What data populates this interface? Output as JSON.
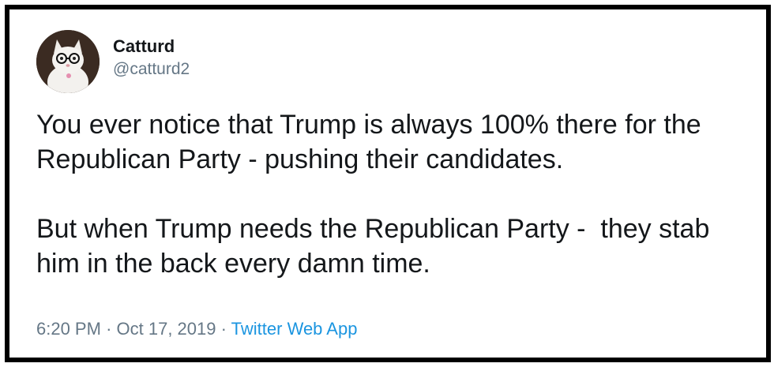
{
  "tweet": {
    "display_name": "Catturd",
    "handle": "@catturd2",
    "avatar_icon": "cat-with-glasses-avatar",
    "paragraphs": [
      "You ever notice that Trump is always 100% there for the Republican Party - pushing their candidates.",
      "But when Trump needs the Republican Party -  they stab him in the back every damn time."
    ],
    "time": "6:20 PM",
    "separator": "·",
    "date": "Oct 17, 2019",
    "source": "Twitter Web App"
  },
  "colors": {
    "text": "#14171a",
    "secondary": "#657786",
    "link": "#1b95e0",
    "frame_border": "#000000"
  }
}
